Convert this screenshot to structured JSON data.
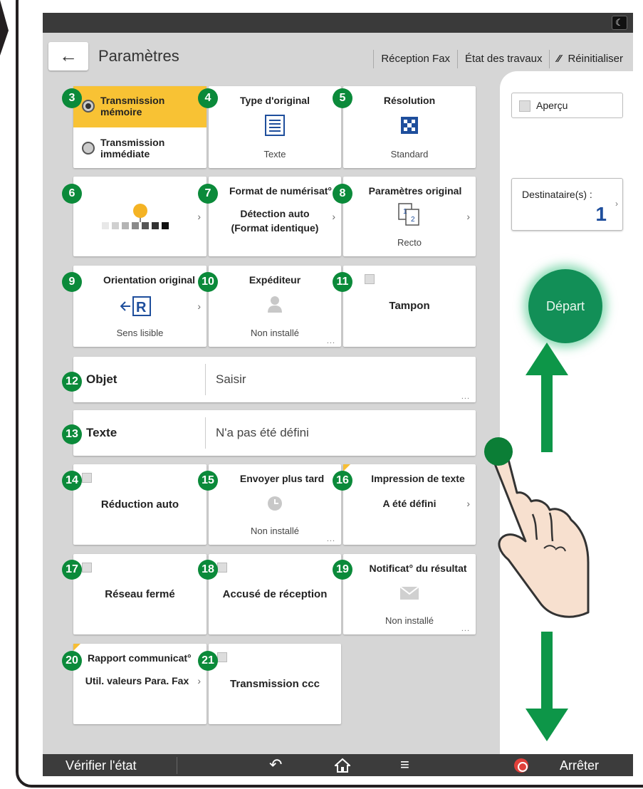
{
  "header": {
    "title": "Paramètres",
    "links": [
      "Réception Fax",
      "État des travaux",
      "Réinitialiser"
    ]
  },
  "tiles": {
    "t3": {
      "badge": "3",
      "option_a": "Transmission\nmémoire",
      "option_b": "Transmission\nimmédiate"
    },
    "t4": {
      "badge": "4",
      "title": "Type d'original",
      "sub": "Texte"
    },
    "t5": {
      "badge": "5",
      "title": "Résolution",
      "sub": "Standard"
    },
    "t6": {
      "badge": "6"
    },
    "t7": {
      "badge": "7",
      "title": "Format de numérisat°",
      "value": "Détection auto\n(Format identique)"
    },
    "t8": {
      "badge": "8",
      "title": "Paramètres original",
      "sub": "Recto"
    },
    "t9": {
      "badge": "9",
      "title": "Orientation original",
      "sub": "Sens lisible"
    },
    "t10": {
      "badge": "10",
      "title": "Expéditeur",
      "sub": "Non installé"
    },
    "t11": {
      "badge": "11",
      "value": "Tampon"
    },
    "t12": {
      "badge": "12",
      "label": "Objet",
      "value": "Saisir"
    },
    "t13": {
      "badge": "13",
      "label": "Texte",
      "value": "N'a pas été défini"
    },
    "t14": {
      "badge": "14",
      "value": "Réduction auto"
    },
    "t15": {
      "badge": "15",
      "title": "Envoyer plus tard",
      "sub": "Non installé"
    },
    "t16": {
      "badge": "16",
      "title": "Impression de texte",
      "value": "A été défini"
    },
    "t17": {
      "badge": "17",
      "value": "Réseau fermé"
    },
    "t18": {
      "badge": "18",
      "value": "Accusé de réception"
    },
    "t19": {
      "badge": "19",
      "title": "Notificat° du résultat",
      "sub": "Non installé"
    },
    "t20": {
      "badge": "20",
      "title": "Rapport communicat°",
      "value": "Util. valeurs Para. Fax"
    },
    "t21": {
      "badge": "21",
      "value": "Transmission ccc"
    }
  },
  "right_panel": {
    "preview": "Aperçu",
    "destinations_label": "Destinataire(s) :",
    "destinations_count": "1",
    "start": "Départ"
  },
  "bottom_bar": {
    "check_status": "Vérifier l'état",
    "stop": "Arrêter"
  },
  "colors": {
    "accent_yellow": "#f8c234",
    "badge_green": "#0b8a3a",
    "start_green": "#128f57"
  }
}
